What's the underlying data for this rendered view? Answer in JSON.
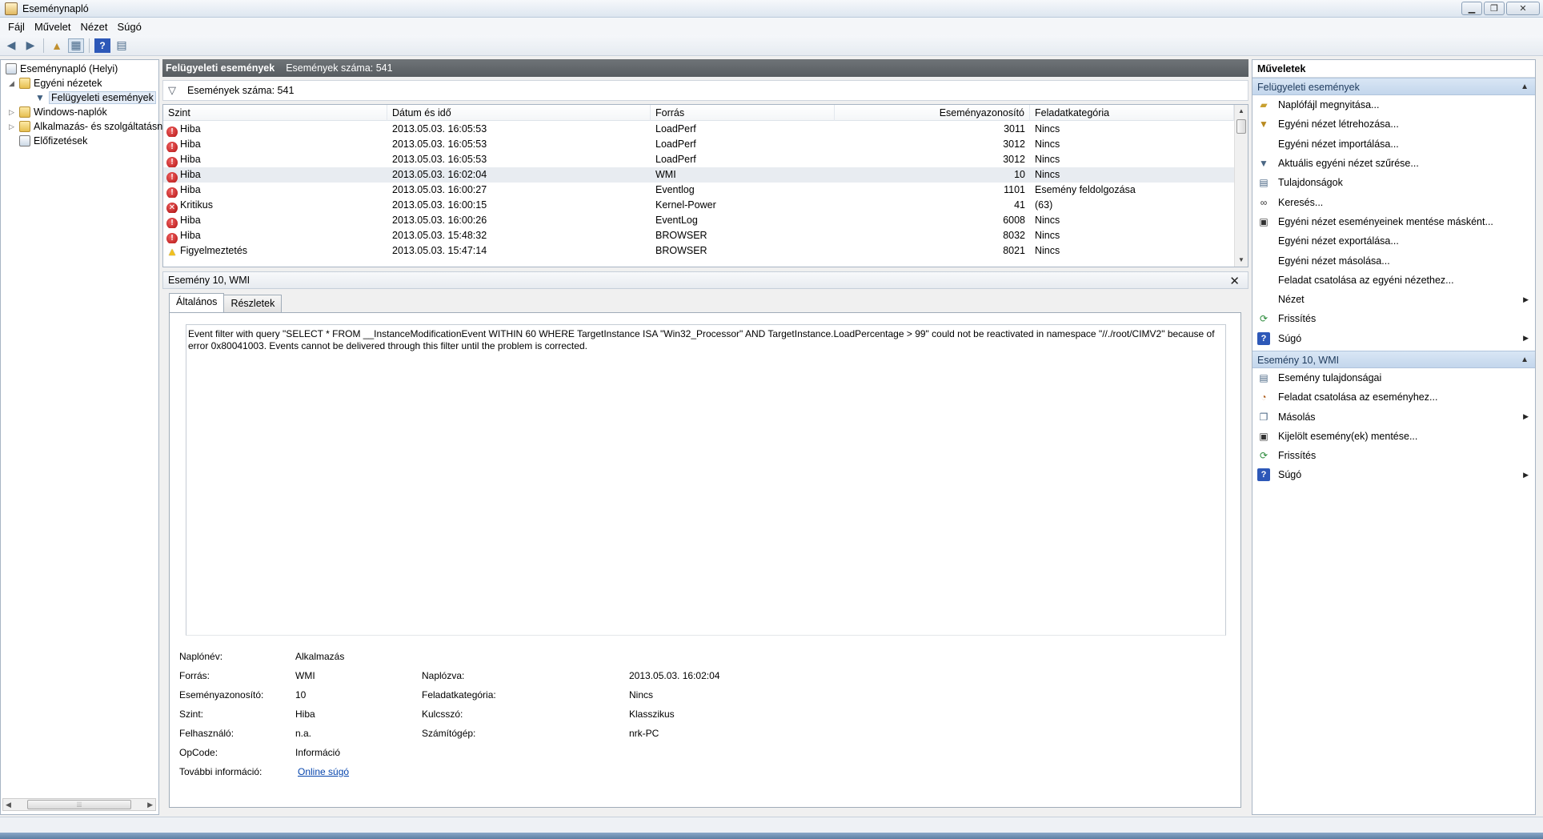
{
  "window": {
    "title": "Eseménynapló"
  },
  "menu": [
    "Fájl",
    "Művelet",
    "Nézet",
    "Súgó"
  ],
  "tree": {
    "items": [
      {
        "label": "Eseménynapló (Helyi)",
        "level": 0,
        "icon": "log-icon"
      },
      {
        "label": "Egyéni nézetek",
        "level": 1,
        "icon": "folder-icon",
        "expanded": true
      },
      {
        "label": "Felügyeleti események",
        "level": 2,
        "icon": "filter-icon",
        "selected": true
      },
      {
        "label": "Windows-naplók",
        "level": 1,
        "icon": "folder-icon"
      },
      {
        "label": "Alkalmazás- és szolgáltatásn",
        "level": 1,
        "icon": "folder-icon"
      },
      {
        "label": "Előfizetések",
        "level": 1,
        "icon": "subscription-icon"
      }
    ]
  },
  "center": {
    "header_title": "Felügyeleti események",
    "header_count": "Események száma: 541",
    "filter_text": "Események száma: 541",
    "columns": [
      "Szint",
      "Dátum és idő",
      "Forrás",
      "Eseményazonosító",
      "Feladatkategória"
    ],
    "rows": [
      {
        "level": "Hiba",
        "type": "error",
        "date": "2013.05.03. 16:05:53",
        "source": "LoadPerf",
        "id": "3011",
        "category": "Nincs"
      },
      {
        "level": "Hiba",
        "type": "error",
        "date": "2013.05.03. 16:05:53",
        "source": "LoadPerf",
        "id": "3012",
        "category": "Nincs"
      },
      {
        "level": "Hiba",
        "type": "error",
        "date": "2013.05.03. 16:05:53",
        "source": "LoadPerf",
        "id": "3012",
        "category": "Nincs"
      },
      {
        "level": "Hiba",
        "type": "error",
        "date": "2013.05.03. 16:02:04",
        "source": "WMI",
        "id": "10",
        "category": "Nincs",
        "selected": true
      },
      {
        "level": "Hiba",
        "type": "error",
        "date": "2013.05.03. 16:00:27",
        "source": "Eventlog",
        "id": "1101",
        "category": "Esemény feldolgozása"
      },
      {
        "level": "Kritikus",
        "type": "critical",
        "date": "2013.05.03. 16:00:15",
        "source": "Kernel-Power",
        "id": "41",
        "category": "(63)"
      },
      {
        "level": "Hiba",
        "type": "error",
        "date": "2013.05.03. 16:00:26",
        "source": "EventLog",
        "id": "6008",
        "category": "Nincs"
      },
      {
        "level": "Hiba",
        "type": "error",
        "date": "2013.05.03. 15:48:32",
        "source": "BROWSER",
        "id": "8032",
        "category": "Nincs"
      },
      {
        "level": "Figyelmeztetés",
        "type": "warning",
        "date": "2013.05.03. 15:47:14",
        "source": "BROWSER",
        "id": "8021",
        "category": "Nincs"
      }
    ],
    "detail": {
      "title": "Esemény 10, WMI",
      "tabs": [
        "Általános",
        "Részletek"
      ],
      "description": "Event filter with query \"SELECT * FROM __InstanceModificationEvent WITHIN 60 WHERE TargetInstance ISA \"Win32_Processor\" AND TargetInstance.LoadPercentage > 99\" could not be reactivated in namespace \"//./root/CIMV2\" because of error 0x80041003. Events cannot be delivered through this filter until the problem is corrected.",
      "fields": {
        "log_name_label": "Naplónév:",
        "log_name": "Alkalmazás",
        "source_label": "Forrás:",
        "source": "WMI",
        "logged_label": "Naplózva:",
        "logged": "2013.05.03. 16:02:04",
        "event_id_label": "Eseményazonosító:",
        "event_id": "10",
        "task_label": "Feladatkategória:",
        "task": "Nincs",
        "level_label": "Szint:",
        "level": "Hiba",
        "keywords_label": "Kulcsszó:",
        "keywords": "Klasszikus",
        "user_label": "Felhasználó:",
        "user": "n.a.",
        "computer_label": "Számítógép:",
        "computer": "nrk-PC",
        "opcode_label": "OpCode:",
        "opcode": "Információ",
        "more_info_label": "További információ:",
        "more_info": "Online súgó"
      }
    }
  },
  "actions": {
    "title": "Műveletek",
    "sections": [
      {
        "title": "Felügyeleti események",
        "items": [
          {
            "label": "Naplófájl megnyitása...",
            "icon": "folder-open-icon"
          },
          {
            "label": "Egyéni nézet létrehozása...",
            "icon": "filter-create-icon"
          },
          {
            "label": "Egyéni nézet importálása...",
            "icon": ""
          },
          {
            "label": "Aktuális egyéni nézet szűrése...",
            "icon": "filter-icon"
          },
          {
            "label": "Tulajdonságok",
            "icon": "properties-icon"
          },
          {
            "label": "Keresés...",
            "icon": "binoculars-icon"
          },
          {
            "label": "Egyéni nézet eseményeinek mentése másként...",
            "icon": "save-icon"
          },
          {
            "label": "Egyéni nézet exportálása...",
            "icon": ""
          },
          {
            "label": "Egyéni nézet másolása...",
            "icon": ""
          },
          {
            "label": "Feladat csatolása az egyéni nézethez...",
            "icon": ""
          },
          {
            "label": "Nézet",
            "icon": "",
            "submenu": true
          },
          {
            "label": "Frissítés",
            "icon": "refresh-icon"
          },
          {
            "label": "Súgó",
            "icon": "help-icon",
            "submenu": true
          }
        ]
      },
      {
        "title": "Esemény 10, WMI",
        "items": [
          {
            "label": "Esemény tulajdonságai",
            "icon": "event-properties-icon"
          },
          {
            "label": "Feladat csatolása az eseményhez...",
            "icon": "task-icon"
          },
          {
            "label": "Másolás",
            "icon": "copy-icon",
            "submenu": true
          },
          {
            "label": "Kijelölt esemény(ek) mentése...",
            "icon": "save-icon"
          },
          {
            "label": "Frissítés",
            "icon": "refresh-icon"
          },
          {
            "label": "Súgó",
            "icon": "help-icon",
            "submenu": true
          }
        ]
      }
    ]
  }
}
